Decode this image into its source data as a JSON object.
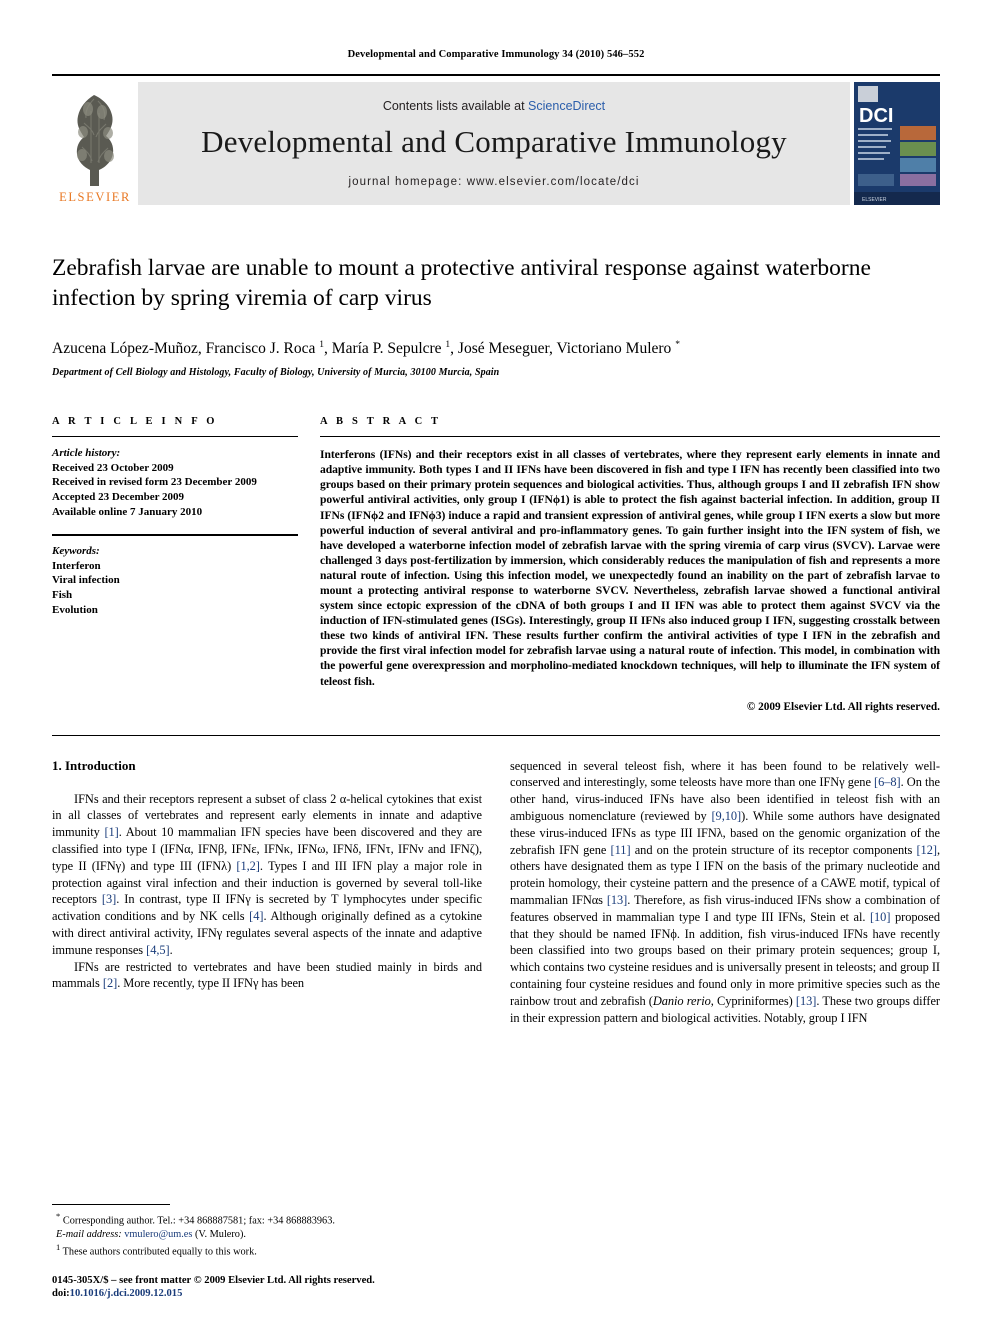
{
  "running_head": "Developmental and Comparative Immunology 34 (2010) 546–552",
  "masthead": {
    "contents_prefix": "Contents lists available at ",
    "sciencedirect": "ScienceDirect",
    "journal_title": "Developmental and Comparative Immunology",
    "homepage": "journal homepage: www.elsevier.com/locate/dci",
    "publisher_name": "ELSEVIER",
    "cover_logo_text": "DCI",
    "cover_subtitle": "DEVELOPMENTAL & COMPARATIVE IMMUNOLOGY",
    "accent_color": "#2b5eab",
    "elsevier_orange": "#E87722",
    "cover_blue": "#1b3a6b"
  },
  "article": {
    "title": "Zebrafish larvae are unable to mount a protective antiviral response against waterborne infection by spring viremia of carp virus",
    "authors_html": "Azucena López-Muñoz, Francisco J. Roca <sup>1</sup>, María P. Sepulcre <sup>1</sup>, José Meseguer, Victoriano Mulero <sup>*</sup>",
    "affiliation": "Department of Cell Biology and Histology, Faculty of Biology, University of Murcia, 30100 Murcia, Spain"
  },
  "article_info": {
    "heading": "A R T I C L E    I N F O",
    "history_label": "Article history:",
    "history": [
      "Received 23 October 2009",
      "Received in revised form 23 December 2009",
      "Accepted 23 December 2009",
      "Available online 7 January 2010"
    ],
    "keywords_label": "Keywords:",
    "keywords": [
      "Interferon",
      "Viral infection",
      "Fish",
      "Evolution"
    ]
  },
  "abstract": {
    "heading": "A B S T R A C T",
    "text": "Interferons (IFNs) and their receptors exist in all classes of vertebrates, where they represent early elements in innate and adaptive immunity. Both types I and II IFNs have been discovered in fish and type I IFN has recently been classified into two groups based on their primary protein sequences and biological activities. Thus, although groups I and II zebrafish IFN show powerful antiviral activities, only group I (IFNϕ1) is able to protect the fish against bacterial infection. In addition, group II IFNs (IFNϕ2 and IFNϕ3) induce a rapid and transient expression of antiviral genes, while group I IFN exerts a slow but more powerful induction of several antiviral and pro-inflammatory genes. To gain further insight into the IFN system of fish, we have developed a waterborne infection model of zebrafish larvae with the spring viremia of carp virus (SVCV). Larvae were challenged 3 days post-fertilization by immersion, which considerably reduces the manipulation of fish and represents a more natural route of infection. Using this infection model, we unexpectedly found an inability on the part of zebrafish larvae to mount a protecting antiviral response to waterborne SVCV. Nevertheless, zebrafish larvae showed a functional antiviral system since ectopic expression of the cDNA of both groups I and II IFN was able to protect them against SVCV via the induction of IFN-stimulated genes (ISGs). Interestingly, group II IFNs also induced group I IFN, suggesting crosstalk between these two kinds of antiviral IFN. These results further confirm the antiviral activities of type I IFN in the zebrafish and provide the first viral infection model for zebrafish larvae using a natural route of infection. This model, in combination with the powerful gene overexpression and morpholino-mediated knockdown techniques, will help to illuminate the IFN system of teleost fish.",
    "copyright": "© 2009 Elsevier Ltd. All rights reserved."
  },
  "introduction": {
    "heading": "1. Introduction",
    "left_paragraphs_html": [
      "IFNs and their receptors represent a subset of class 2 α-helical cytokines that exist in all classes of vertebrates and represent early elements in innate and adaptive immunity <span class=\"ref\">[1]</span>. About 10 mammalian IFN species have been discovered and they are classified into type I (IFNα, IFNβ, IFNε, IFNκ, IFNω, IFNδ, IFNτ, IFNν and IFNζ), type II (IFNγ) and type III (IFNλ) <span class=\"ref\">[1,2]</span>. Types I and III IFN play a major role in protection against viral infection and their induction is governed by several toll-like receptors <span class=\"ref\">[3]</span>. In contrast, type II IFNγ is secreted by T lymphocytes under specific activation conditions and by NK cells <span class=\"ref\">[4]</span>. Although originally defined as a cytokine with direct antiviral activity, IFNγ regulates several aspects of the innate and adaptive immune responses <span class=\"ref\">[4,5]</span>.",
      "IFNs are restricted to vertebrates and have been studied mainly in birds and mammals <span class=\"ref\">[2]</span>. More recently, type II IFNγ has been"
    ],
    "right_paragraphs_html": [
      "sequenced in several teleost fish, where it has been found to be relatively well-conserved and interestingly, some teleosts have more than one IFNγ gene <span class=\"ref\">[6–8]</span>. On the other hand, virus-induced IFNs have also been identified in teleost fish with an ambiguous nomenclature (reviewed by <span class=\"ref\">[9,10]</span>). While some authors have designated these virus-induced IFNs as type III IFNλ, based on the genomic organization of the zebrafish IFN gene <span class=\"ref\">[11]</span> and on the protein structure of its receptor components <span class=\"ref\">[12]</span>, others have designated them as type I IFN on the basis of the primary nucleotide and protein homology, their cysteine pattern and the presence of a CAWE motif, typical of mammalian IFNαs <span class=\"ref\">[13]</span>. Therefore, as fish virus-induced IFNs show a combination of features observed in mammalian type I and type III IFNs, Stein et al. <span class=\"ref\">[10]</span> proposed that they should be named IFNϕ. In addition, fish virus-induced IFNs have recently been classified into two groups based on their primary protein sequences; group I, which contains two cysteine residues and is universally present in teleosts; and group II containing four cysteine residues and found only in more primitive species such as the rainbow trout and zebrafish (<span class=\"ital\">Danio rerio</span>, Cypriniformes) <span class=\"ref\">[13]</span>. These two groups differ in their expression pattern and biological activities. Notably, group I IFN"
    ]
  },
  "footnotes": {
    "corresponding_html": "<span class=\"fn-mark\">*</span> Corresponding author. Tel.: +34 868887581; fax: +34 868883963.",
    "email_html": "<span class=\"fn-ital\">E-mail address:</span> <span class=\"fn-link\">vmulero@um.es</span> (V. Mulero).",
    "equal_contrib_html": "<span class=\"fn-mark\">1</span> These authors contributed equally to this work."
  },
  "imprint": {
    "line1": "0145-305X/$ – see front matter © 2009 Elsevier Ltd. All rights reserved.",
    "doi_label": "doi:",
    "doi_value": "10.1016/j.dci.2009.12.015"
  }
}
